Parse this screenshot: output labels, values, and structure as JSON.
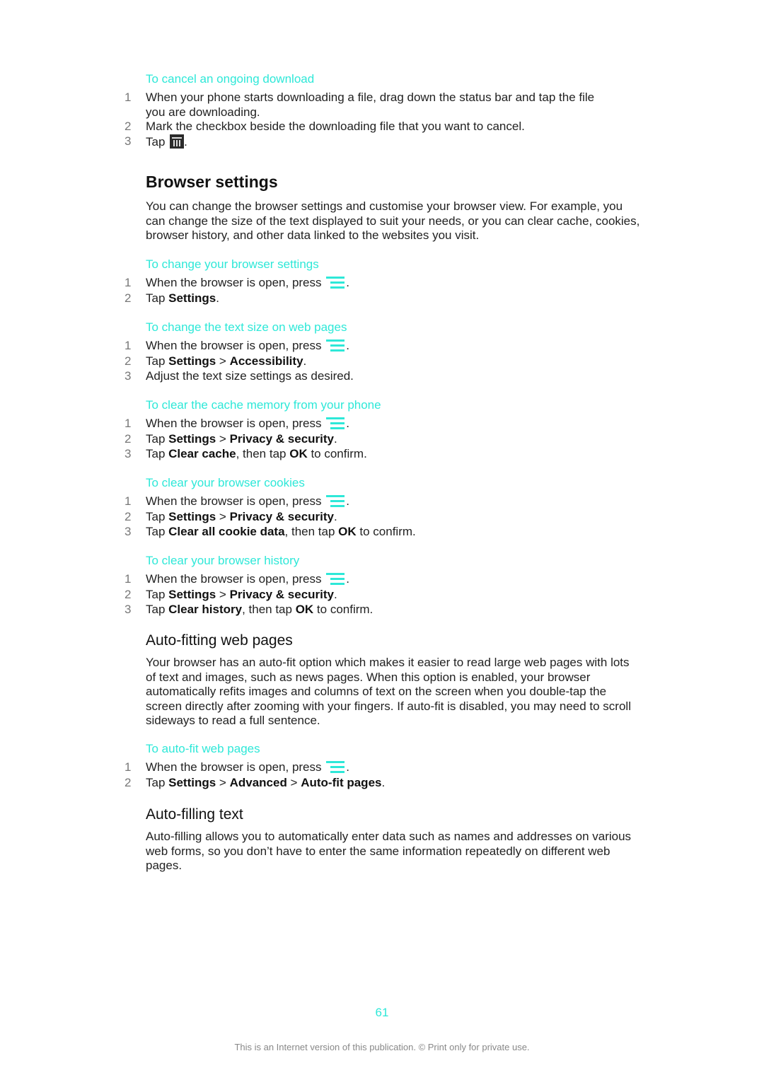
{
  "sections": {
    "cancel_download": {
      "title": "To cancel an ongoing download",
      "steps": [
        {
          "num": "1",
          "text": "When your phone starts downloading a file, drag down the status bar and tap the file you are downloading."
        },
        {
          "num": "2",
          "text": "Mark the checkbox beside the downloading file that you want to cancel."
        },
        {
          "num": "3",
          "pre": "Tap",
          "icon": "trash-icon",
          "post": "."
        }
      ]
    },
    "browser_settings": {
      "heading": "Browser settings",
      "body": "You can change the browser settings and customise your browser view. For example, you can change the size of the text displayed to suit your needs, or you can clear cache, cookies, browser history, and other data linked to the websites you visit."
    },
    "change_settings": {
      "title": "To change your browser settings",
      "steps": [
        {
          "num": "1",
          "pre": "When the browser is open, press",
          "icon": "menu-icon",
          "post": "."
        },
        {
          "num": "2",
          "pre": "Tap ",
          "b1": "Settings",
          "post": "."
        }
      ]
    },
    "text_size": {
      "title": "To change the text size on web pages",
      "steps": [
        {
          "num": "1",
          "pre": "When the browser is open, press",
          "icon": "menu-icon",
          "post": "."
        },
        {
          "num": "2",
          "pre": "Tap ",
          "b1": "Settings",
          "sep": " > ",
          "b2": "Accessibility",
          "post": "."
        },
        {
          "num": "3",
          "text": "Adjust the text size settings as desired."
        }
      ]
    },
    "clear_cache": {
      "title": "To clear the cache memory from your phone",
      "steps": [
        {
          "num": "1",
          "pre": "When the browser is open, press",
          "icon": "menu-icon",
          "post": "."
        },
        {
          "num": "2",
          "pre": "Tap ",
          "b1": "Settings",
          "sep": " > ",
          "b2": "Privacy & security",
          "post": "."
        },
        {
          "num": "3",
          "pre": "Tap ",
          "b1": "Clear cache",
          "mid": ", then tap ",
          "b2": "OK",
          "post": " to confirm."
        }
      ]
    },
    "clear_cookies": {
      "title": "To clear your browser cookies",
      "steps": [
        {
          "num": "1",
          "pre": "When the browser is open, press",
          "icon": "menu-icon",
          "post": "."
        },
        {
          "num": "2",
          "pre": "Tap ",
          "b1": "Settings",
          "sep": " > ",
          "b2": "Privacy & security",
          "post": "."
        },
        {
          "num": "3",
          "pre": "Tap ",
          "b1": "Clear all cookie data",
          "mid": ", then tap ",
          "b2": "OK",
          "post": " to confirm."
        }
      ]
    },
    "clear_history": {
      "title": "To clear your browser history",
      "steps": [
        {
          "num": "1",
          "pre": "When the browser is open, press",
          "icon": "menu-icon",
          "post": "."
        },
        {
          "num": "2",
          "pre": "Tap ",
          "b1": "Settings",
          "sep": " > ",
          "b2": "Privacy & security",
          "post": "."
        },
        {
          "num": "3",
          "pre": "Tap ",
          "b1": "Clear history",
          "mid": ", then tap ",
          "b2": "OK",
          "post": " to confirm."
        }
      ]
    },
    "auto_fitting": {
      "heading": "Auto-fitting web pages",
      "body": "Your browser has an auto-fit option which makes it easier to read large web pages with lots of text and images, such as news pages. When this option is enabled, your browser automatically refits images and columns of text on the screen when you double-tap the screen directly after zooming with your fingers. If auto-fit is disabled, you may need to scroll sideways to read a full sentence."
    },
    "auto_fit_pages": {
      "title": "To auto-fit web pages",
      "steps": [
        {
          "num": "1",
          "pre": "When the browser is open, press",
          "icon": "menu-icon",
          "post": "."
        },
        {
          "num": "2",
          "pre": "Tap ",
          "b1": "Settings",
          "sep": " > ",
          "b2": "Advanced",
          "sep2": " > ",
          "b3": "Auto-fit pages",
          "post": "."
        }
      ]
    },
    "auto_filling": {
      "heading": "Auto-filling text",
      "body": "Auto-filling allows you to automatically enter data such as names and addresses on various web forms, so you don’t have to enter the same information repeatedly on different web pages."
    }
  },
  "page_number": "61",
  "footer": "This is an Internet version of this publication. © Print only for private use.",
  "colors": {
    "accent": "#2ee8d8",
    "text": "#222222",
    "step_number": "#777777",
    "footer": "#888888"
  }
}
